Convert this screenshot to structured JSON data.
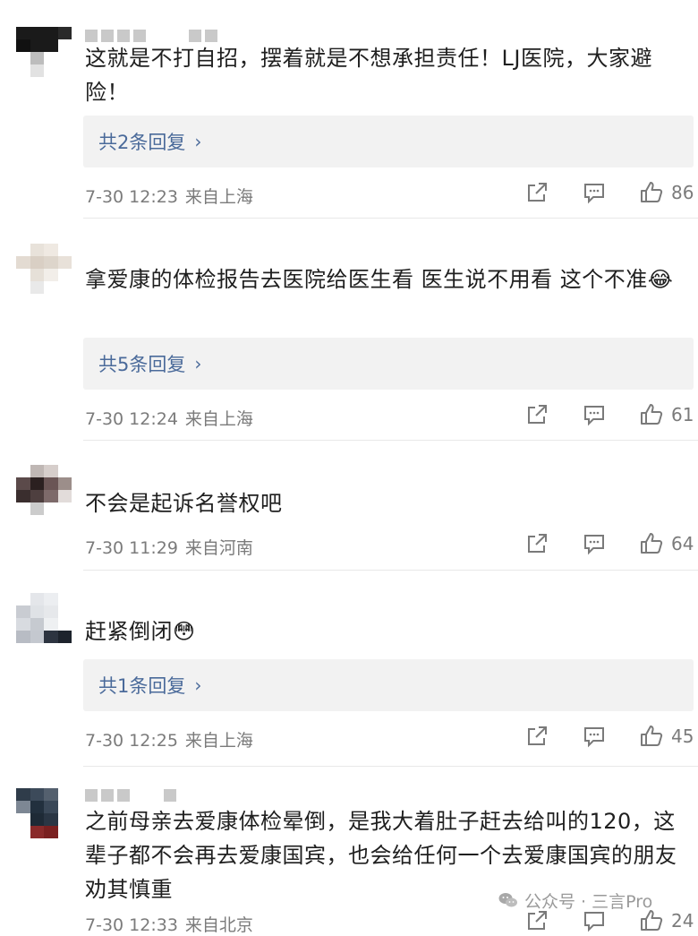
{
  "comments": [
    {
      "text": "这就是不打自招，摆着就是不想承担责任！LJ医院，大家避险！",
      "reply_label": "共2条回复",
      "time": "7-30 12:23",
      "location": "来自上海",
      "likes": "86"
    },
    {
      "text": "拿爱康的体检报告去医院给医生看 医生说不用看 这个不准😂",
      "reply_label": "共5条回复",
      "time": "7-30 12:24",
      "location": "来自上海",
      "likes": "61"
    },
    {
      "text": "不会是起诉名誉权吧",
      "time": "7-30 11:29",
      "location": "来自河南",
      "likes": "64"
    },
    {
      "text": "赶紧倒闭😳",
      "reply_label": "共1条回复",
      "time": "7-30 12:25",
      "location": "来自上海",
      "likes": "45"
    },
    {
      "text": "之前母亲去爱康体检晕倒，是我大着肚子赶去给叫的120，这辈子都不会再去爱康国宾，也会给任何一个去爱康国宾的朋友劝其慎重",
      "time": "7-30 12:33",
      "location": "来自北京",
      "likes": "24"
    }
  ],
  "reply_chevron": "›",
  "watermark": {
    "text": "公众号 · 三言Pro"
  },
  "icons": {
    "share": "share-icon",
    "comment": "comment-icon",
    "like": "thumbs-up-icon"
  }
}
